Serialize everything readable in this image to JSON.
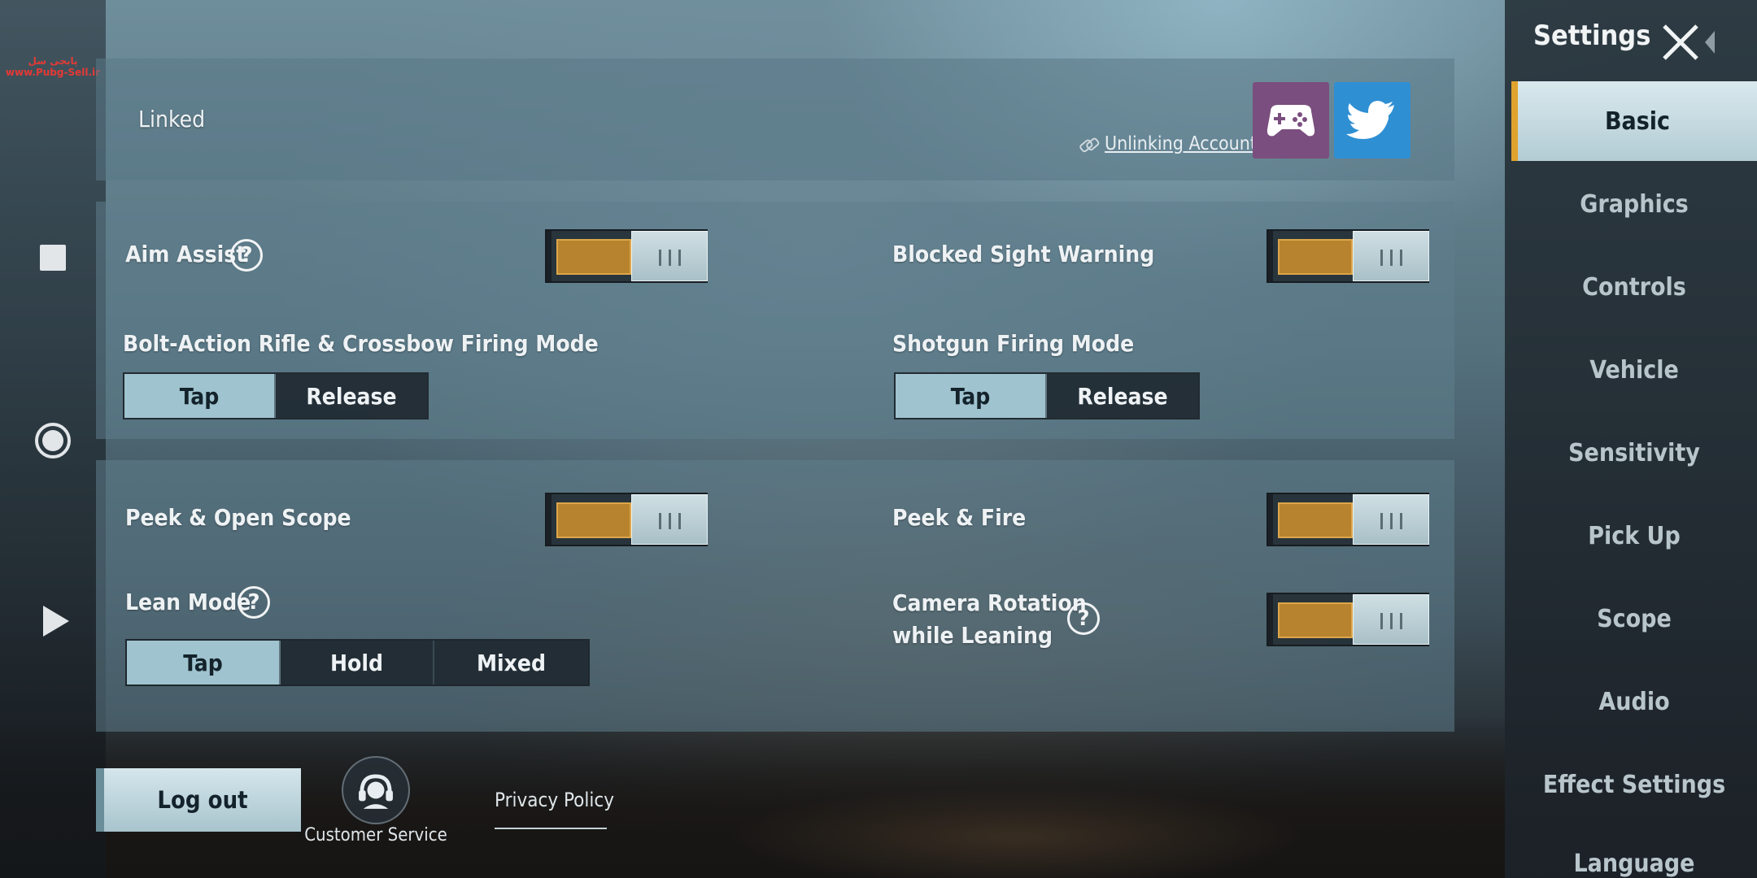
{
  "watermark": {
    "line1": "پابجی سل",
    "line2": "www.Pubg-Sell.ir"
  },
  "linked": {
    "label": "Linked",
    "unlink_label": "Unlinking Accounts",
    "accounts": [
      "game-controller-icon",
      "twitter-icon"
    ]
  },
  "section1": {
    "aim_assist": {
      "label": "Aim Assist",
      "on": true
    },
    "blocked_sight_warning": {
      "label": "Blocked Sight Warning",
      "on": true
    },
    "bolt_action": {
      "label": "Bolt-Action Rifle & Crossbow Firing Mode",
      "options": [
        "Tap",
        "Release"
      ],
      "selected": "Tap"
    },
    "shotgun": {
      "label": "Shotgun Firing Mode",
      "options": [
        "Tap",
        "Release"
      ],
      "selected": "Tap"
    }
  },
  "section2": {
    "peek_open_scope": {
      "label": "Peek & Open Scope",
      "on": true
    },
    "peek_fire": {
      "label": "Peek & Fire",
      "on": true
    },
    "lean_mode": {
      "label": "Lean Mode",
      "options": [
        "Tap",
        "Hold",
        "Mixed"
      ],
      "selected": "Tap"
    },
    "camera_rotation": {
      "label_line1": "Camera Rotation",
      "label_line2": "while Leaning",
      "on": true
    }
  },
  "footer": {
    "logout_label": "Log out",
    "customer_service_label": "Customer Service",
    "privacy_label": "Privacy Policy"
  },
  "sidebar": {
    "title": "Settings",
    "items": [
      {
        "label": "Basic",
        "active": true
      },
      {
        "label": "Graphics",
        "active": false
      },
      {
        "label": "Controls",
        "active": false
      },
      {
        "label": "Vehicle",
        "active": false
      },
      {
        "label": "Sensitivity",
        "active": false
      },
      {
        "label": "Pick Up",
        "active": false
      },
      {
        "label": "Scope",
        "active": false
      },
      {
        "label": "Audio",
        "active": false
      },
      {
        "label": "Effect Settings",
        "active": false
      },
      {
        "label": "Language",
        "active": false
      }
    ]
  },
  "colors": {
    "accent_orange": "#b8832e",
    "sidebar_active_marker": "#e0a32e",
    "selected_option": "#9fc3cf",
    "twitter_blue": "#2f8fd3",
    "game_center_purple": "#7a4e7e"
  }
}
